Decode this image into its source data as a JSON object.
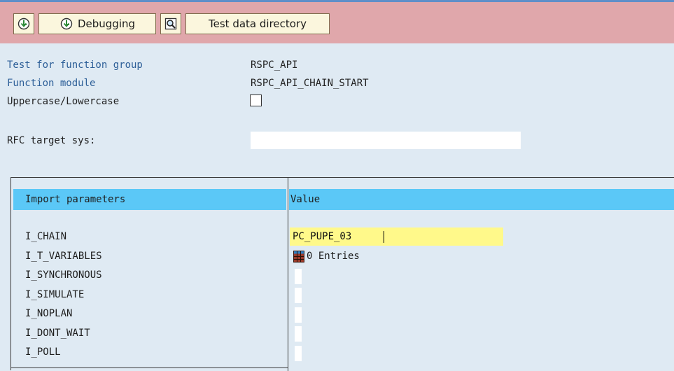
{
  "toolbar": {
    "execute_label": "",
    "debugging_label": "Debugging",
    "test_data_label": "Test data directory"
  },
  "header": {
    "function_group_label": "Test for function group",
    "function_group_value": "RSPC_API",
    "function_module_label": "Function module",
    "function_module_value": "RSPC_API_CHAIN_START",
    "case_label": "Uppercase/Lowercase",
    "case_checked": false,
    "rfc_label": "RFC target sys:",
    "rfc_value": ""
  },
  "table": {
    "col_param_header": "Import parameters",
    "col_value_header": "Value",
    "rows": [
      {
        "name": "I_CHAIN",
        "value": "PC_PUPE_03"
      },
      {
        "name": "I_T_VARIABLES",
        "value": "0 Entries"
      },
      {
        "name": "I_SYNCHRONOUS",
        "value": ""
      },
      {
        "name": "I_SIMULATE",
        "value": ""
      },
      {
        "name": "I_NOPLAN",
        "value": ""
      },
      {
        "name": "I_DONT_WAIT",
        "value": ""
      },
      {
        "name": "I_POLL",
        "value": ""
      }
    ]
  },
  "colors": {
    "toolbar_bg": "#e0a7ab",
    "page_bg": "#dfeaf3",
    "header_bg": "#5bc8f7",
    "label_blue": "#2d5f98",
    "highlight_yellow": "#fff98a"
  },
  "icons": [
    "execute-icon",
    "debug-execute-icon",
    "test-data-directory-icon",
    "table-entries-icon"
  ]
}
